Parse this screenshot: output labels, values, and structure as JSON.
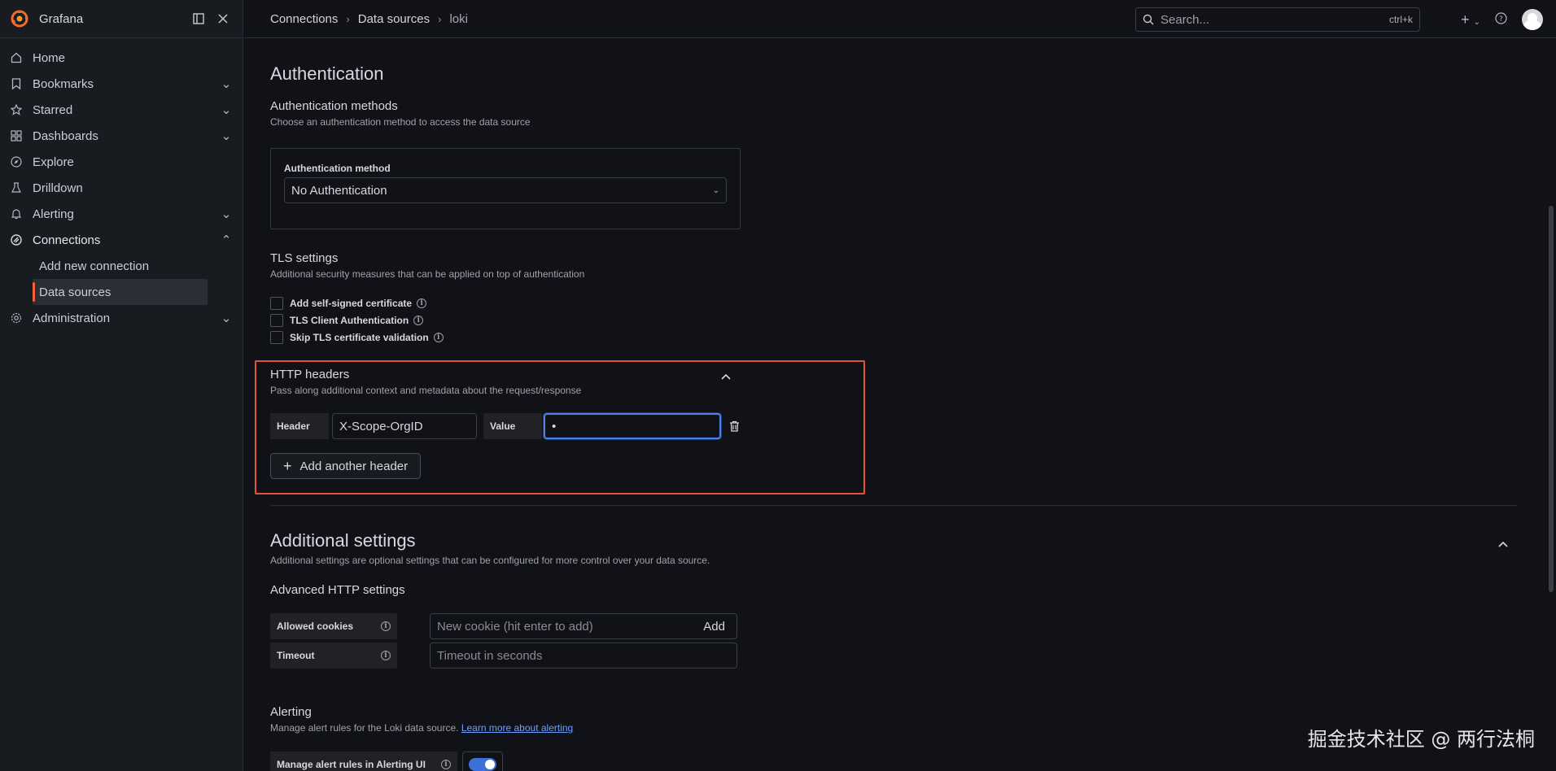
{
  "app": {
    "name": "Grafana"
  },
  "breadcrumb": [
    "Connections",
    "Data sources",
    "loki"
  ],
  "search": {
    "placeholder": "Search...",
    "shortcut": "ctrl+k"
  },
  "sidebar": {
    "items": [
      {
        "label": "Home",
        "icon": "home-icon"
      },
      {
        "label": "Bookmarks",
        "icon": "bookmark-icon"
      },
      {
        "label": "Starred",
        "icon": "star-icon"
      },
      {
        "label": "Dashboards",
        "icon": "dashboards-icon"
      },
      {
        "label": "Explore",
        "icon": "compass-icon"
      },
      {
        "label": "Drilldown",
        "icon": "drilldown-icon"
      },
      {
        "label": "Alerting",
        "icon": "bell-icon"
      },
      {
        "label": "Connections",
        "icon": "connections-icon"
      },
      {
        "label": "Administration",
        "icon": "gear-icon"
      }
    ],
    "connections_children": [
      "Add new connection",
      "Data sources"
    ]
  },
  "auth": {
    "title": "Authentication",
    "methods_title": "Authentication methods",
    "methods_desc": "Choose an authentication method to access the data source",
    "method_label": "Authentication method",
    "method_value": "No Authentication"
  },
  "tls": {
    "title": "TLS settings",
    "desc": "Additional security measures that can be applied on top of authentication",
    "options": [
      "Add self-signed certificate",
      "TLS Client Authentication",
      "Skip TLS certificate validation"
    ]
  },
  "http_headers": {
    "title": "HTTP headers",
    "desc": "Pass along additional context and metadata about the request/response",
    "header_label": "Header",
    "header_value": "X-Scope-OrgID",
    "value_label": "Value",
    "value_masked": "•",
    "add_button": "Add another header"
  },
  "additional": {
    "title": "Additional settings",
    "desc": "Additional settings are optional settings that can be configured for more control over your data source.",
    "advanced_title": "Advanced HTTP settings",
    "allowed_cookies_label": "Allowed cookies",
    "allowed_cookies_placeholder": "New cookie (hit enter to add)",
    "add_label": "Add",
    "timeout_label": "Timeout",
    "timeout_placeholder": "Timeout in seconds"
  },
  "alerting": {
    "title": "Alerting",
    "desc": "Manage alert rules for the Loki data source.",
    "link": "Learn more about alerting",
    "toggle_label": "Manage alert rules in Alerting UI",
    "toggle_on": true
  },
  "watermark": "掘金技术社区 @ 两行法桐",
  "colors": {
    "accent": "#f55f3e",
    "highlight_border": "#e4503a",
    "focus": "#4d82e6",
    "link": "#6e9fff"
  }
}
